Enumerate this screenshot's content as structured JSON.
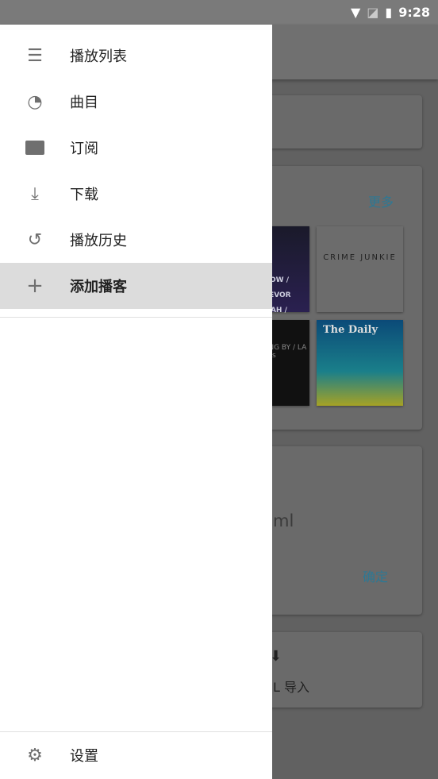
{
  "status_bar": {
    "time": "9:28",
    "icons": [
      "wifi-icon",
      "no-sim-icon",
      "battery-charging-icon"
    ]
  },
  "background": {
    "more_label": "更多",
    "podcasts": [
      "SHOW / TREVOR NOAH / UNIVERSE",
      "CRIME JUNKIE",
      "…SING BY / LA Times",
      "The Daily"
    ],
    "field_suffix": "ml",
    "confirm_label": "确定",
    "import_label": "L 导入"
  },
  "drawer": {
    "items": [
      {
        "label": "播放列表",
        "icon": "list-icon"
      },
      {
        "label": "曲目",
        "icon": "rss-feed-icon"
      },
      {
        "label": "订阅",
        "icon": "folder-icon"
      },
      {
        "label": "下载",
        "icon": "download-icon"
      },
      {
        "label": "播放历史",
        "icon": "history-icon"
      },
      {
        "label": "添加播客",
        "icon": "plus-icon",
        "selected": true
      }
    ],
    "settings": {
      "label": "设置",
      "icon": "gear-icon"
    }
  }
}
